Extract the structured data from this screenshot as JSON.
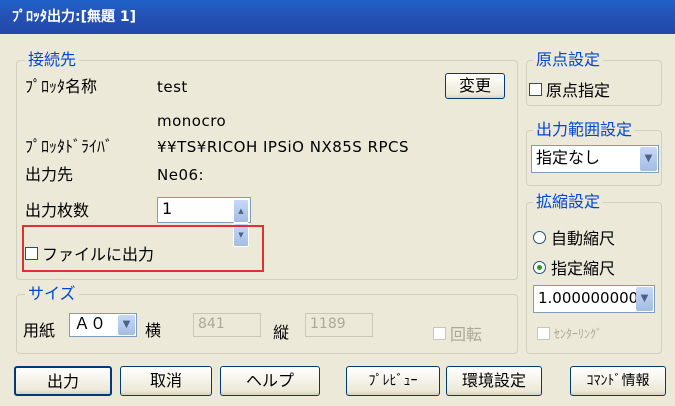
{
  "window": {
    "title": "ﾌﾟﾛｯﾀ出力:[無題 1]"
  },
  "connection": {
    "legend": "接続先",
    "plotter_name_label": "ﾌﾟﾛｯﾀ名称",
    "plotter_name": "test",
    "change_button": "変更",
    "model": "monocro",
    "driver_label": "ﾌﾟﾛｯﾀﾄﾞﾗｲﾊﾞ",
    "driver": "¥¥TS¥RICOH IPSiO NX85S RPCS",
    "output_to_label": "出力先",
    "output_to": "Ne06:",
    "copies_label": "出力枚数",
    "copies_value": "1",
    "file_output_label": "ファイルに出力"
  },
  "size": {
    "legend": "サイズ",
    "paper_label": "用紙",
    "paper_value": "Ａ０",
    "width_label": "横",
    "width_value": "841",
    "height_label": "縦",
    "height_value": "1189",
    "rotate_label": "回転"
  },
  "origin": {
    "legend": "原点設定",
    "specify_label": "原点指定"
  },
  "output_range": {
    "legend": "出力範囲設定",
    "value": "指定なし"
  },
  "scale": {
    "legend": "拡縮設定",
    "auto_label": "自動縮尺",
    "specified_label": "指定縮尺",
    "scale_value": "1.000000000",
    "centering_label": "ｾﾝﾀｰﾘﾝｸﾞ"
  },
  "buttons": {
    "output": "出力",
    "cancel": "取消",
    "help": "ヘルプ",
    "preview": "ﾌﾟﾚﾋﾞｭｰ",
    "environment": "環境設定",
    "command_info": "ｺﾏﾝﾄﾞ情報"
  }
}
